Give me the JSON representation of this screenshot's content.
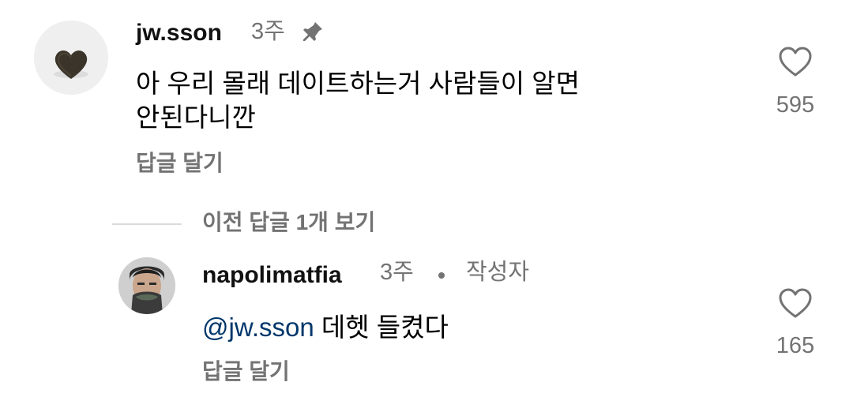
{
  "comment": {
    "username": "jw.sson",
    "time": "3주",
    "pinned_icon": "pin-icon",
    "text_line1": "아 우리 몰래 데이트하는거 사람들이 알면",
    "text_line2": "안된다니깐",
    "reply_label": "답글 달기",
    "like_count": "595",
    "like_icon": "heart-icon"
  },
  "view_previous_replies": "이전 답글 1개 보기",
  "reply": {
    "username": "napolimatfia",
    "time": "3주",
    "separator": "•",
    "author_label": "작성자",
    "mention_symbol": "@",
    "mention": "jw.sson",
    "text": "데헷 들켰다",
    "reply_label": "답글 달기",
    "like_count": "165",
    "like_icon": "heart-icon"
  },
  "colors": {
    "secondary_text": "#737373",
    "mention_blue": "#00376b",
    "divider": "#dbdbdb"
  }
}
